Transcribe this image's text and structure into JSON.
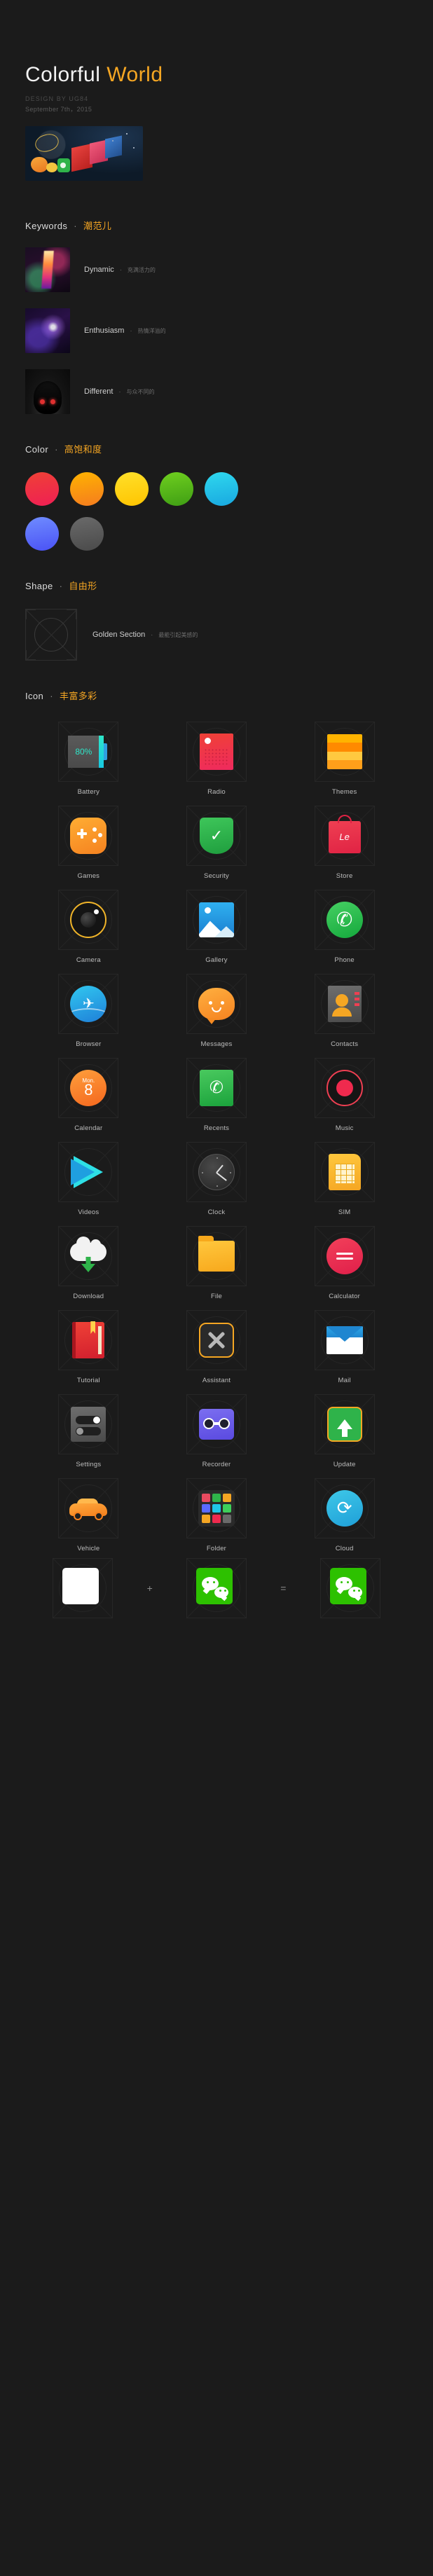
{
  "header": {
    "title_part1": "Colorful",
    "title_part2": "World",
    "designer": "DESIGN BY UG84",
    "date": "September 7th，2015"
  },
  "sections": {
    "keywords": {
      "en": "Keywords",
      "sep": "·",
      "cn": "潮范儿"
    },
    "color": {
      "en": "Color",
      "sep": "·",
      "cn": "高饱和度"
    },
    "shape": {
      "en": "Shape",
      "sep": "·",
      "cn": "自由形"
    },
    "icon": {
      "en": "Icon",
      "sep": "·",
      "cn": "丰富多彩"
    }
  },
  "keywords": [
    {
      "en": "Dynamic",
      "sep": "·",
      "cn": "充满活力的"
    },
    {
      "en": "Enthusiasm",
      "sep": "·",
      "cn": "热情洋溢的"
    },
    {
      "en": "Different",
      "sep": "·",
      "cn": "与众不同的"
    }
  ],
  "colors": [
    {
      "name": "red",
      "hex": "#ef2a4e"
    },
    {
      "name": "orange",
      "hex": "#f58220"
    },
    {
      "name": "yellow",
      "hex": "#ffd21a"
    },
    {
      "name": "green",
      "hex": "#4caf1f"
    },
    {
      "name": "cyan",
      "hex": "#1fc8e8"
    },
    {
      "name": "blue",
      "hex": "#5a6aff"
    },
    {
      "name": "gray",
      "hex": "#5a5a5a"
    }
  ],
  "shape": {
    "en": "Golden Section",
    "sep": "·",
    "cn": "最能引起美感的"
  },
  "icons": [
    {
      "label": "Battery",
      "badge": "80%"
    },
    {
      "label": "Radio"
    },
    {
      "label": "Themes"
    },
    {
      "label": "Games"
    },
    {
      "label": "Security"
    },
    {
      "label": "Store",
      "badge": "Le"
    },
    {
      "label": "Camera"
    },
    {
      "label": "Gallery"
    },
    {
      "label": "Phone"
    },
    {
      "label": "Browser"
    },
    {
      "label": "Messages"
    },
    {
      "label": "Contacts"
    },
    {
      "label": "Calendar",
      "day": "Mon.",
      "date": "8"
    },
    {
      "label": "Recents"
    },
    {
      "label": "Music"
    },
    {
      "label": "Videos"
    },
    {
      "label": "Clock"
    },
    {
      "label": "SIM"
    },
    {
      "label": "Download"
    },
    {
      "label": "File"
    },
    {
      "label": "Calculator"
    },
    {
      "label": "Tutorial"
    },
    {
      "label": "Assistant"
    },
    {
      "label": "Mail"
    },
    {
      "label": "Settings"
    },
    {
      "label": "Recorder"
    },
    {
      "label": "Update"
    },
    {
      "label": "Vehicle"
    },
    {
      "label": "Folder"
    },
    {
      "label": "Cloud"
    }
  ],
  "formula": {
    "plus": "+",
    "equals": "="
  }
}
